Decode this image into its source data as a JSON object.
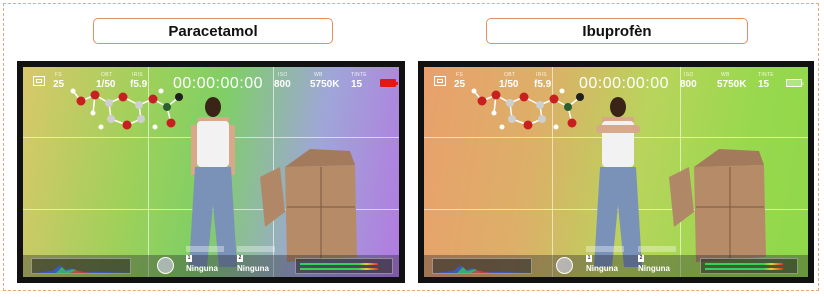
{
  "panels": [
    {
      "title": "Paracetamol",
      "hud": {
        "fps_label": "FS",
        "fps": "25",
        "shutter_label": "OBT",
        "shutter": "1/50",
        "iris_label": "IRIS",
        "iris": "f5.9",
        "timecode": "00:00:00:00",
        "iso_label": "ISO",
        "iso": "800",
        "wb_label": "WB",
        "wb": "5750K",
        "tint_label": "TINTE",
        "tint": "15",
        "battery_color": "#e01818",
        "slot1": "Ninguna",
        "slot2": "Ninguna",
        "slot1_num": "1",
        "slot2_num": "2"
      }
    },
    {
      "title": "Ibuprofèn",
      "hud": {
        "fps_label": "FS",
        "fps": "25",
        "shutter_label": "OBT",
        "shutter": "1/50",
        "iris_label": "IRIS",
        "iris": "f5.9",
        "timecode": "00:00:00:00",
        "iso_label": "ISO",
        "iso": "800",
        "wb_label": "WB",
        "wb": "5750K",
        "tint_label": "TINTE",
        "tint": "15",
        "battery_color": "#ffffff",
        "slot1": "Ninguna",
        "slot2": "Ninguna",
        "slot1_num": "1",
        "slot2_num": "2"
      }
    }
  ]
}
